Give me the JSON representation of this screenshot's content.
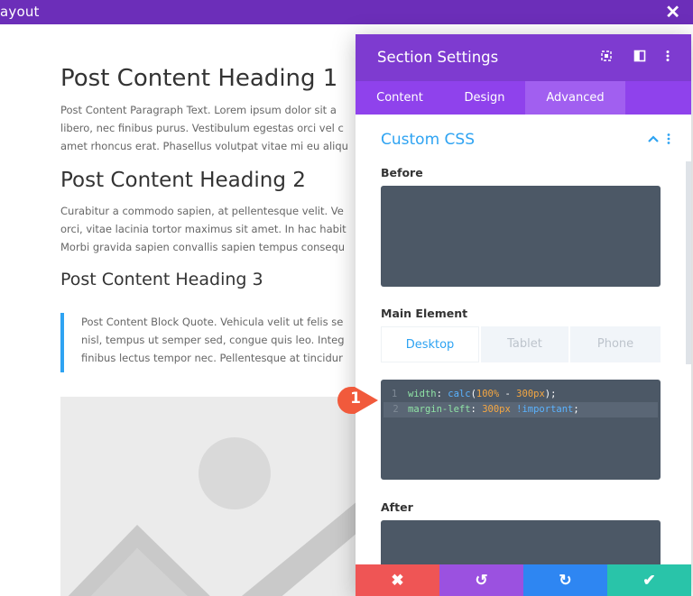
{
  "window": {
    "title": "ayout",
    "close_glyph": "✕"
  },
  "content": {
    "heading1": "Post Content Heading 1",
    "paragraph1": [
      "Post Content Paragraph Text. Lorem ipsum dolor sit a",
      "libero, nec finibus purus. Vestibulum egestas orci vel c",
      "amet rhoncus erat. Phasellus volutpat vitae mi eu aliqu"
    ],
    "heading2": "Post Content Heading 2",
    "paragraph2": [
      "Curabitur a commodo sapien, at pellentesque velit. Ve",
      "orci, vitae lacinia tortor maximus sit amet. In hac habit",
      "Morbi gravida sapien convallis sapien tempus consequ"
    ],
    "heading3": "Post Content Heading 3",
    "blockquote": [
      "Post Content Block Quote. Vehicula velit ut felis se",
      "nisl, tempus ut semper sed, congue quis leo. Integ",
      "finibus lectus tempor nec. Pellentesque at tincidur"
    ]
  },
  "panel": {
    "title": "Section Settings",
    "header_icons": [
      "expand-icon",
      "split-view-icon",
      "more-vertical-icon"
    ],
    "tabs": [
      {
        "label": "Content",
        "active": false
      },
      {
        "label": "Design",
        "active": false
      },
      {
        "label": "Advanced",
        "active": true
      }
    ],
    "section_title": "Custom CSS",
    "before_label": "Before",
    "main_element_label": "Main Element",
    "device_tabs": [
      {
        "label": "Desktop",
        "active": true
      },
      {
        "label": "Tablet",
        "active": false
      },
      {
        "label": "Phone",
        "active": false
      }
    ],
    "code": {
      "line1_no": "1",
      "line1_prop": "width",
      "line1_fn": "calc",
      "line1_arg": "100%",
      "line1_op": "-",
      "line1_val": "300px",
      "line2_no": "2",
      "line2_prop": "margin-left",
      "line2_val": "300px",
      "line2_kw": "!important"
    },
    "after_label": "After",
    "callout_number": "1"
  },
  "footer": {
    "buttons": [
      {
        "name": "discard",
        "glyph": "✖",
        "color": "#ef5555"
      },
      {
        "name": "undo",
        "glyph": "↺",
        "color": "#9b51e0"
      },
      {
        "name": "redo",
        "glyph": "↻",
        "color": "#2e86f2"
      },
      {
        "name": "save",
        "glyph": "✔",
        "color": "#29c4a9"
      }
    ]
  },
  "colors": {
    "topbar": "#6c2eb9",
    "panel_header": "#7e3bd0",
    "tabs": "#8f42ec",
    "accent_blue": "#2ea3f2",
    "code_bg": "#4c5866",
    "callout": "#f15a3c"
  }
}
